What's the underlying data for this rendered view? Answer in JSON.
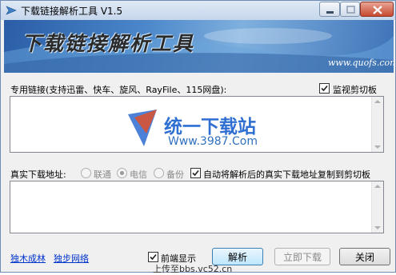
{
  "window": {
    "title": "下载链接解析工具 V1.5",
    "banner_title": "下载链接解析工具",
    "banner_site": "www.quofs.com"
  },
  "links_section": {
    "label": "专用链接(支持迅雷、快车、旋风、RayFile、115网盘):",
    "monitor_clipboard": {
      "label": "监视剪切板",
      "checked": true
    },
    "value": ""
  },
  "real_section": {
    "label": "真实下载地址:",
    "radios": [
      {
        "label": "联通",
        "selected": false
      },
      {
        "label": "电信",
        "selected": true
      },
      {
        "label": "备份",
        "selected": false
      }
    ],
    "auto_copy": {
      "label": "自动将解析后的真实下载地址复制到剪切板",
      "checked": true
    },
    "value": ""
  },
  "watermark": {
    "title": "统一下载站",
    "url": "Www.3987.Com"
  },
  "footer": {
    "links": [
      "独木成林",
      "独步网络"
    ],
    "front_display": {
      "label": "前端显示",
      "checked": true
    },
    "parse_button": "解析",
    "download_button": "立即下载",
    "close_button": "关闭",
    "upload_note": "上传至bbs.vc52.cn"
  },
  "colors": {
    "banner": "#3d73b8",
    "link": "#0033cc",
    "close": "#c74a31"
  }
}
